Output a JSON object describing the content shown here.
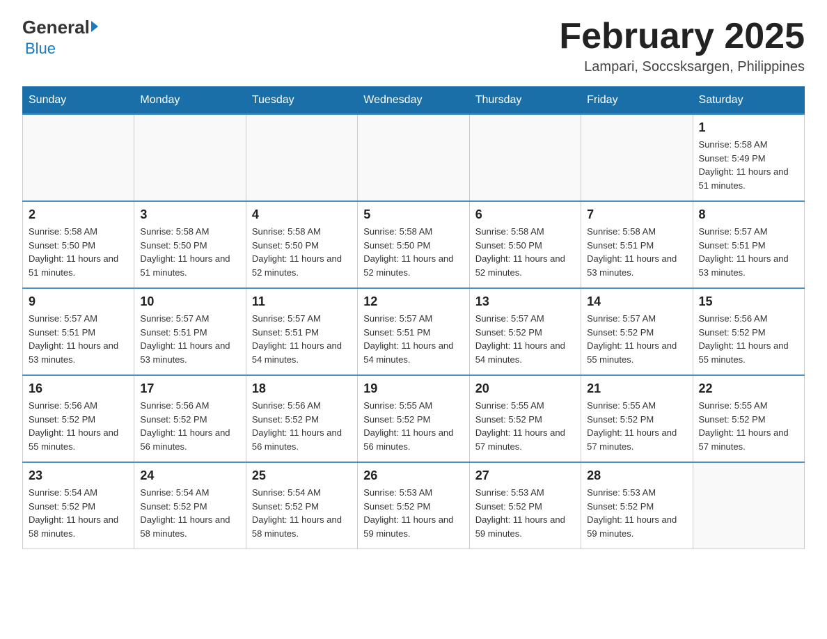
{
  "logo": {
    "general": "General",
    "blue": "Blue"
  },
  "title": "February 2025",
  "subtitle": "Lampari, Soccsksargen, Philippines",
  "days_of_week": [
    "Sunday",
    "Monday",
    "Tuesday",
    "Wednesday",
    "Thursday",
    "Friday",
    "Saturday"
  ],
  "weeks": [
    [
      {
        "day": "",
        "info": ""
      },
      {
        "day": "",
        "info": ""
      },
      {
        "day": "",
        "info": ""
      },
      {
        "day": "",
        "info": ""
      },
      {
        "day": "",
        "info": ""
      },
      {
        "day": "",
        "info": ""
      },
      {
        "day": "1",
        "info": "Sunrise: 5:58 AM\nSunset: 5:49 PM\nDaylight: 11 hours and 51 minutes."
      }
    ],
    [
      {
        "day": "2",
        "info": "Sunrise: 5:58 AM\nSunset: 5:50 PM\nDaylight: 11 hours and 51 minutes."
      },
      {
        "day": "3",
        "info": "Sunrise: 5:58 AM\nSunset: 5:50 PM\nDaylight: 11 hours and 51 minutes."
      },
      {
        "day": "4",
        "info": "Sunrise: 5:58 AM\nSunset: 5:50 PM\nDaylight: 11 hours and 52 minutes."
      },
      {
        "day": "5",
        "info": "Sunrise: 5:58 AM\nSunset: 5:50 PM\nDaylight: 11 hours and 52 minutes."
      },
      {
        "day": "6",
        "info": "Sunrise: 5:58 AM\nSunset: 5:50 PM\nDaylight: 11 hours and 52 minutes."
      },
      {
        "day": "7",
        "info": "Sunrise: 5:58 AM\nSunset: 5:51 PM\nDaylight: 11 hours and 53 minutes."
      },
      {
        "day": "8",
        "info": "Sunrise: 5:57 AM\nSunset: 5:51 PM\nDaylight: 11 hours and 53 minutes."
      }
    ],
    [
      {
        "day": "9",
        "info": "Sunrise: 5:57 AM\nSunset: 5:51 PM\nDaylight: 11 hours and 53 minutes."
      },
      {
        "day": "10",
        "info": "Sunrise: 5:57 AM\nSunset: 5:51 PM\nDaylight: 11 hours and 53 minutes."
      },
      {
        "day": "11",
        "info": "Sunrise: 5:57 AM\nSunset: 5:51 PM\nDaylight: 11 hours and 54 minutes."
      },
      {
        "day": "12",
        "info": "Sunrise: 5:57 AM\nSunset: 5:51 PM\nDaylight: 11 hours and 54 minutes."
      },
      {
        "day": "13",
        "info": "Sunrise: 5:57 AM\nSunset: 5:52 PM\nDaylight: 11 hours and 54 minutes."
      },
      {
        "day": "14",
        "info": "Sunrise: 5:57 AM\nSunset: 5:52 PM\nDaylight: 11 hours and 55 minutes."
      },
      {
        "day": "15",
        "info": "Sunrise: 5:56 AM\nSunset: 5:52 PM\nDaylight: 11 hours and 55 minutes."
      }
    ],
    [
      {
        "day": "16",
        "info": "Sunrise: 5:56 AM\nSunset: 5:52 PM\nDaylight: 11 hours and 55 minutes."
      },
      {
        "day": "17",
        "info": "Sunrise: 5:56 AM\nSunset: 5:52 PM\nDaylight: 11 hours and 56 minutes."
      },
      {
        "day": "18",
        "info": "Sunrise: 5:56 AM\nSunset: 5:52 PM\nDaylight: 11 hours and 56 minutes."
      },
      {
        "day": "19",
        "info": "Sunrise: 5:55 AM\nSunset: 5:52 PM\nDaylight: 11 hours and 56 minutes."
      },
      {
        "day": "20",
        "info": "Sunrise: 5:55 AM\nSunset: 5:52 PM\nDaylight: 11 hours and 57 minutes."
      },
      {
        "day": "21",
        "info": "Sunrise: 5:55 AM\nSunset: 5:52 PM\nDaylight: 11 hours and 57 minutes."
      },
      {
        "day": "22",
        "info": "Sunrise: 5:55 AM\nSunset: 5:52 PM\nDaylight: 11 hours and 57 minutes."
      }
    ],
    [
      {
        "day": "23",
        "info": "Sunrise: 5:54 AM\nSunset: 5:52 PM\nDaylight: 11 hours and 58 minutes."
      },
      {
        "day": "24",
        "info": "Sunrise: 5:54 AM\nSunset: 5:52 PM\nDaylight: 11 hours and 58 minutes."
      },
      {
        "day": "25",
        "info": "Sunrise: 5:54 AM\nSunset: 5:52 PM\nDaylight: 11 hours and 58 minutes."
      },
      {
        "day": "26",
        "info": "Sunrise: 5:53 AM\nSunset: 5:52 PM\nDaylight: 11 hours and 59 minutes."
      },
      {
        "day": "27",
        "info": "Sunrise: 5:53 AM\nSunset: 5:52 PM\nDaylight: 11 hours and 59 minutes."
      },
      {
        "day": "28",
        "info": "Sunrise: 5:53 AM\nSunset: 5:52 PM\nDaylight: 11 hours and 59 minutes."
      },
      {
        "day": "",
        "info": ""
      }
    ]
  ],
  "colors": {
    "header_bg": "#1a6fa8",
    "header_text": "#ffffff",
    "border": "#4a90c4"
  }
}
